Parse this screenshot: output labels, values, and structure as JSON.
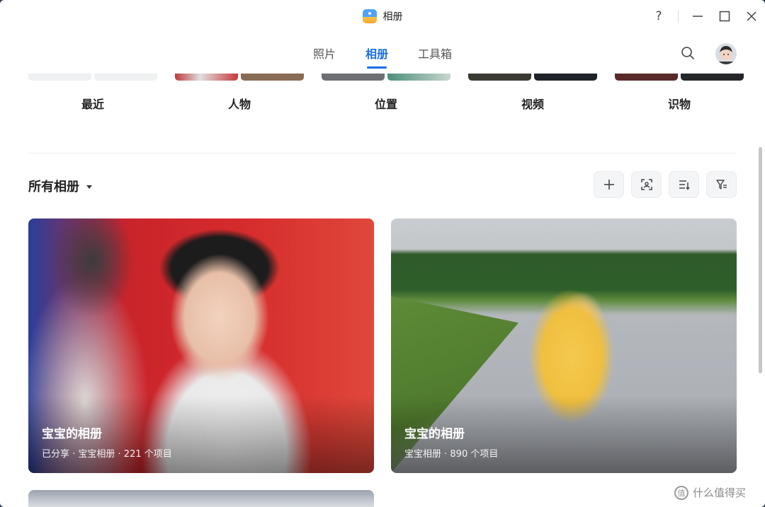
{
  "window": {
    "title": "相册",
    "controls": {
      "help": "?",
      "minimize": "—",
      "maximize": "☐",
      "close": "✕"
    }
  },
  "nav": {
    "tabs": [
      {
        "label": "照片",
        "active": false
      },
      {
        "label": "相册",
        "active": true
      },
      {
        "label": "工具箱",
        "active": false
      }
    ],
    "search_icon": "search-icon",
    "accent_color": "#1a6fe8"
  },
  "categories": [
    {
      "label": "最近"
    },
    {
      "label": "人物"
    },
    {
      "label": "位置"
    },
    {
      "label": "视频"
    },
    {
      "label": "识物"
    }
  ],
  "albums_section": {
    "title": "所有相册",
    "tools": [
      {
        "icon": "add-icon"
      },
      {
        "icon": "face-scan-icon"
      },
      {
        "icon": "sort-icon"
      },
      {
        "icon": "filter-icon"
      }
    ]
  },
  "albums": [
    {
      "name": "宝宝的相册",
      "meta": "已分享 · 宝宝相册 · 221 个项目"
    },
    {
      "name": "宝宝的相册",
      "meta": "宝宝相册 · 890 个项目"
    }
  ],
  "watermark": {
    "icon": "值",
    "text": "什么值得买"
  }
}
